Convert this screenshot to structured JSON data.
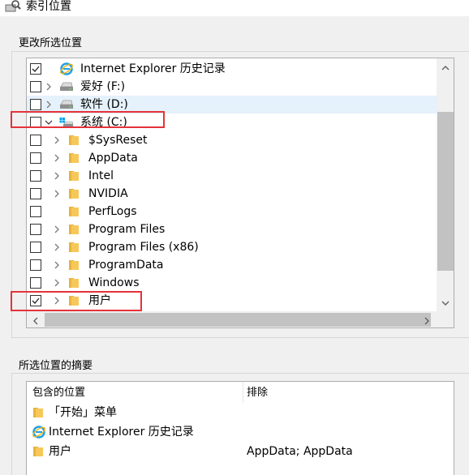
{
  "window": {
    "title": "索引位置"
  },
  "tree_section": {
    "label": "更改所选位置"
  },
  "tree": {
    "rows": [
      {
        "label": "Internet Explorer 历史记录",
        "checked": true,
        "expander": "none",
        "icon": "ie-icon"
      },
      {
        "label": "爱好 (F:)",
        "checked": false,
        "expander": "collapsed",
        "icon": "drive-icon"
      },
      {
        "label": "软件 (D:)",
        "checked": false,
        "expander": "collapsed",
        "icon": "drive-icon"
      },
      {
        "label": "系统 (C:)",
        "checked": false,
        "expander": "expanded",
        "icon": "system-drive-icon"
      },
      {
        "label": "$SysReset",
        "checked": false,
        "expander": "collapsed",
        "icon": "folder-icon"
      },
      {
        "label": "AppData",
        "checked": false,
        "expander": "collapsed",
        "icon": "folder-icon"
      },
      {
        "label": "Intel",
        "checked": false,
        "expander": "collapsed",
        "icon": "folder-icon"
      },
      {
        "label": "NVIDIA",
        "checked": false,
        "expander": "collapsed",
        "icon": "folder-icon"
      },
      {
        "label": "PerfLogs",
        "checked": false,
        "expander": "none",
        "icon": "folder-icon"
      },
      {
        "label": "Program Files",
        "checked": false,
        "expander": "collapsed",
        "icon": "folder-icon"
      },
      {
        "label": "Program Files (x86)",
        "checked": false,
        "expander": "collapsed",
        "icon": "folder-icon"
      },
      {
        "label": "ProgramData",
        "checked": false,
        "expander": "collapsed",
        "icon": "folder-icon"
      },
      {
        "label": "Windows",
        "checked": false,
        "expander": "collapsed",
        "icon": "folder-icon"
      },
      {
        "label": "用户",
        "checked": true,
        "expander": "collapsed",
        "icon": "folder-icon"
      }
    ]
  },
  "summary_section": {
    "label": "所选位置的摘要"
  },
  "summary": {
    "col_included": "包含的位置",
    "col_excluded": "排除",
    "rows": [
      {
        "included": "「开始」菜单",
        "excluded": "",
        "icon": "folder-icon"
      },
      {
        "included": "Internet Explorer 历史记录",
        "excluded": "",
        "icon": "ie-icon"
      },
      {
        "included": "用户",
        "excluded": "AppData; AppData",
        "icon": "folder-icon"
      }
    ]
  },
  "colors": {
    "highlight_box": "#e5333a",
    "row_hover": "#e5f1fb",
    "folder": "#f7c859"
  }
}
